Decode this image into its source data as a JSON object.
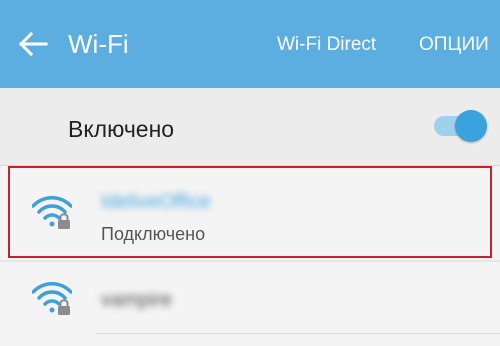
{
  "appbar": {
    "title": "Wi-Fi",
    "wifi_direct_label": "Wi-Fi Direct",
    "options_label": "ОПЦИИ",
    "back_icon": "arrow-left-icon",
    "color": "#5cade0"
  },
  "wifi_toggle": {
    "label": "Включено",
    "state": "on",
    "accent": "#3aa2dc"
  },
  "networks": [
    {
      "ssid": "IdeliveOffice",
      "status": "Подключено",
      "icon": "wifi-locked-icon",
      "highlighted": true
    },
    {
      "ssid": "vampire",
      "icon": "wifi-locked-icon"
    }
  ]
}
